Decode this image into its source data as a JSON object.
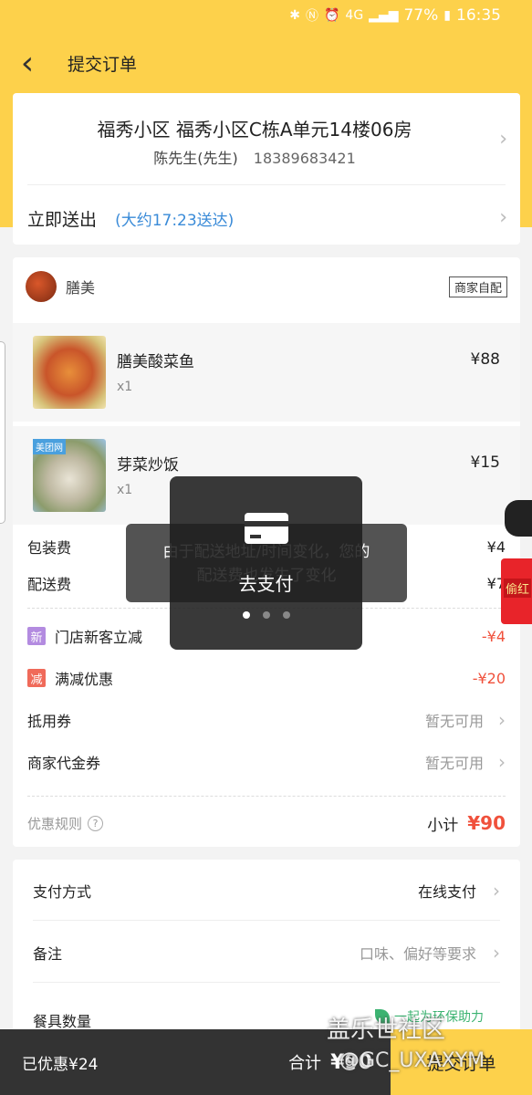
{
  "status_bar": {
    "battery": "77%",
    "time": "16:35",
    "network": "4G"
  },
  "header": {
    "title": "提交订单"
  },
  "address": {
    "main": "福秀小区 福秀小区C栋A单元14楼06房",
    "contact_name": "陈先生(先生)",
    "phone": "18389683421",
    "deliver_label": "立即送出",
    "deliver_eta": "(大约17:23送达)"
  },
  "shop": {
    "name": "膳美",
    "tag": "商家自配"
  },
  "items": [
    {
      "name": "膳美酸菜鱼",
      "qty": "x1",
      "price": "¥88"
    },
    {
      "name": "芽菜炒饭",
      "qty": "x1",
      "price": "¥15",
      "brand": "美团网"
    }
  ],
  "fees": [
    {
      "label": "包装费",
      "amount": "¥4"
    },
    {
      "label": "配送费",
      "amount": "¥7"
    }
  ],
  "promos": [
    {
      "badge": "新",
      "label": "门店新客立减",
      "amount": "-¥4"
    },
    {
      "badge": "减",
      "label": "满减优惠",
      "amount": "-¥20"
    }
  ],
  "coupons": [
    {
      "label": "抵用券",
      "value": "暂无可用"
    },
    {
      "label": "商家代金券",
      "value": "暂无可用"
    }
  ],
  "rules": {
    "label": "优惠规则",
    "subtotal_label": "小计",
    "subtotal": "¥90"
  },
  "payment": {
    "method_label": "支付方式",
    "method_value": "在线支付",
    "note_label": "备注",
    "note_value": "口味、偏好等要求",
    "utensils_label": "餐具数量",
    "eco_text": "一起为环保助力"
  },
  "bottom": {
    "saved": "已优惠¥24",
    "total_label": "合计",
    "total": "¥90",
    "submit": "提交订单"
  },
  "toast": {
    "line1": "由于配送地址/时间变化，您的",
    "line2": "配送费也发生了变化"
  },
  "modal": {
    "label": "去支付"
  },
  "promo_float": {
    "text": "偷红"
  },
  "watermark": {
    "line1": "盖乐世社区",
    "line2": "@GC_UXAXYM"
  },
  "colors": {
    "brand": "#fdd14b",
    "price_red": "#f0513c",
    "eta_blue": "#3a8bd8"
  }
}
